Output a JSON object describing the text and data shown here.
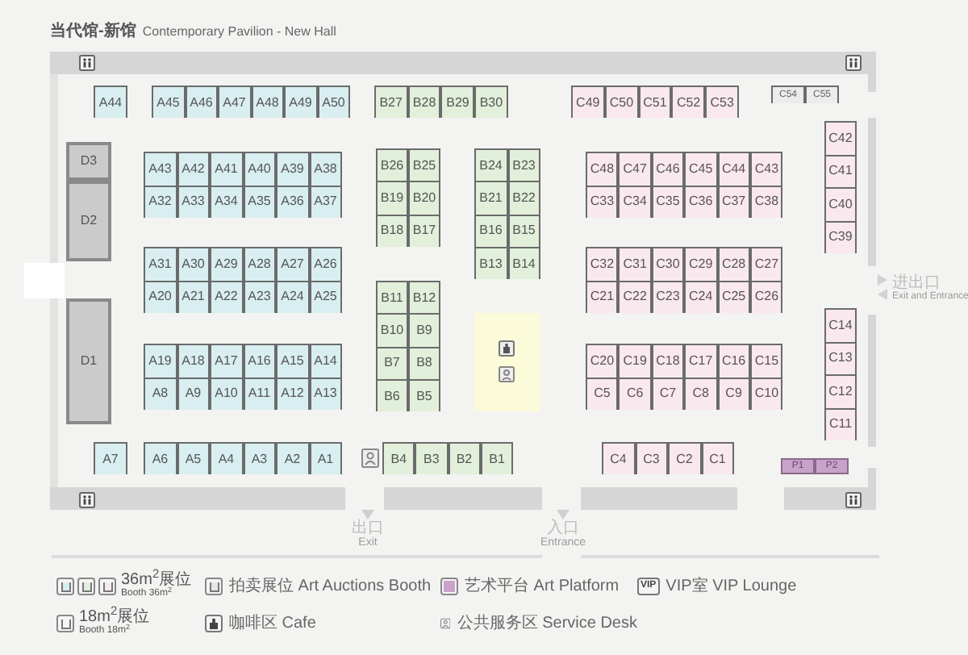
{
  "header": {
    "title_cn": "当代馆-新馆",
    "title_en": "Contemporary Pavilion - New Hall"
  },
  "booth_blocks": [
    {
      "kind": "a",
      "rows": [
        [
          "A44"
        ]
      ]
    },
    {
      "kind": "a",
      "rows": [
        [
          "A45",
          "A46",
          "A47",
          "A48",
          "A49",
          "A50"
        ]
      ]
    },
    {
      "kind": "b",
      "rows": [
        [
          "B27",
          "B28",
          "B29",
          "B30"
        ]
      ]
    },
    {
      "kind": "c",
      "rows": [
        [
          "C49",
          "C50",
          "C51",
          "C52",
          "C53"
        ]
      ]
    },
    {
      "kind": "small",
      "rows": [
        [
          "C54",
          "C55"
        ]
      ]
    },
    {
      "kind": "d",
      "rows": [
        [
          "D3"
        ]
      ]
    },
    {
      "kind": "d",
      "rows": [
        [
          "D2"
        ]
      ]
    },
    {
      "kind": "a",
      "rows": [
        [
          "A43",
          "A42",
          "A41",
          "A40",
          "A39",
          "A38"
        ],
        [
          "A32",
          "A33",
          "A34",
          "A35",
          "A36",
          "A37"
        ]
      ]
    },
    {
      "kind": "b",
      "rows": [
        [
          "B26",
          "B25"
        ],
        [
          "B19",
          "B20"
        ],
        [
          "B18",
          "B17"
        ]
      ]
    },
    {
      "kind": "b",
      "rows": [
        [
          "B24",
          "B23"
        ],
        [
          "B21",
          "B22"
        ],
        [
          "B16",
          "B15"
        ],
        [
          "B13",
          "B14"
        ]
      ]
    },
    {
      "kind": "c",
      "rows": [
        [
          "C48",
          "C47",
          "C46",
          "C45",
          "C44",
          "C43"
        ],
        [
          "C33",
          "C34",
          "C35",
          "C36",
          "C37",
          "C38"
        ]
      ]
    },
    {
      "kind": "c",
      "rows": [
        [
          "C42"
        ],
        [
          "C41"
        ],
        [
          "C40"
        ],
        [
          "C39"
        ]
      ]
    },
    {
      "kind": "a",
      "rows": [
        [
          "A31",
          "A30",
          "A29",
          "A28",
          "A27",
          "A26"
        ],
        [
          "A20",
          "A21",
          "A22",
          "A23",
          "A24",
          "A25"
        ]
      ]
    },
    {
      "kind": "b",
      "rows": [
        [
          "B11",
          "B12"
        ],
        [
          "B10",
          "B9"
        ],
        [
          "B7",
          "B8"
        ],
        [
          "B6",
          "B5"
        ]
      ]
    },
    {
      "kind": "c",
      "rows": [
        [
          "C32",
          "C31",
          "C30",
          "C29",
          "C28",
          "C27"
        ],
        [
          "C21",
          "C22",
          "C23",
          "C24",
          "C25",
          "C26"
        ]
      ]
    },
    {
      "kind": "d",
      "rows": [
        [
          "D1"
        ]
      ]
    },
    {
      "kind": "a",
      "rows": [
        [
          "A19",
          "A18",
          "A17",
          "A16",
          "A15",
          "A14"
        ],
        [
          "A8",
          "A9",
          "A10",
          "A11",
          "A12",
          "A13"
        ]
      ]
    },
    {
      "kind": "c",
      "rows": [
        [
          "C20",
          "C19",
          "C18",
          "C17",
          "C16",
          "C15"
        ],
        [
          "C5",
          "C6",
          "C7",
          "C8",
          "C9",
          "C10"
        ]
      ]
    },
    {
      "kind": "c",
      "rows": [
        [
          "C14"
        ],
        [
          "C13"
        ],
        [
          "C12"
        ],
        [
          "C11"
        ]
      ]
    },
    {
      "kind": "a",
      "rows": [
        [
          "A7"
        ]
      ]
    },
    {
      "kind": "a",
      "rows": [
        [
          "A6",
          "A5",
          "A4",
          "A3",
          "A2",
          "A1"
        ]
      ]
    },
    {
      "kind": "b",
      "rows": [
        [
          "B4",
          "B3",
          "B2",
          "B1"
        ]
      ]
    },
    {
      "kind": "c",
      "rows": [
        [
          "C4",
          "C3",
          "C2",
          "C1"
        ]
      ]
    },
    {
      "kind": "platform",
      "rows": [
        [
          "P1",
          "P2"
        ]
      ]
    }
  ],
  "doors": [
    {
      "kind": "down",
      "label_cn": "出口",
      "label_en": "Exit"
    },
    {
      "kind": "down",
      "label_cn": "入口",
      "label_en": "Entrance"
    },
    {
      "kind": "side",
      "label_cn": "进出口",
      "label_en": "Exit and Entrance"
    }
  ],
  "legend": [
    {
      "kind": "booth36",
      "label": "36m$^{2}$展位",
      "sublabel": "Booth 36m$^{2}$"
    },
    {
      "kind": "auction",
      "label": "拍卖展位 Art Auctions Booth"
    },
    {
      "kind": "platform",
      "label": "艺术平台 Art Platform"
    },
    {
      "kind": "vip",
      "icon_text": "VIP",
      "label": "VIP室 VIP Lounge"
    },
    {
      "kind": "booth18",
      "label": "18m$^{2}$展位",
      "sublabel": "Booth 18m$^{2}$"
    },
    {
      "kind": "cafe",
      "label": "咖啡区 Cafe"
    },
    {
      "kind": "service",
      "label": "公共服务区 Service Desk"
    }
  ]
}
